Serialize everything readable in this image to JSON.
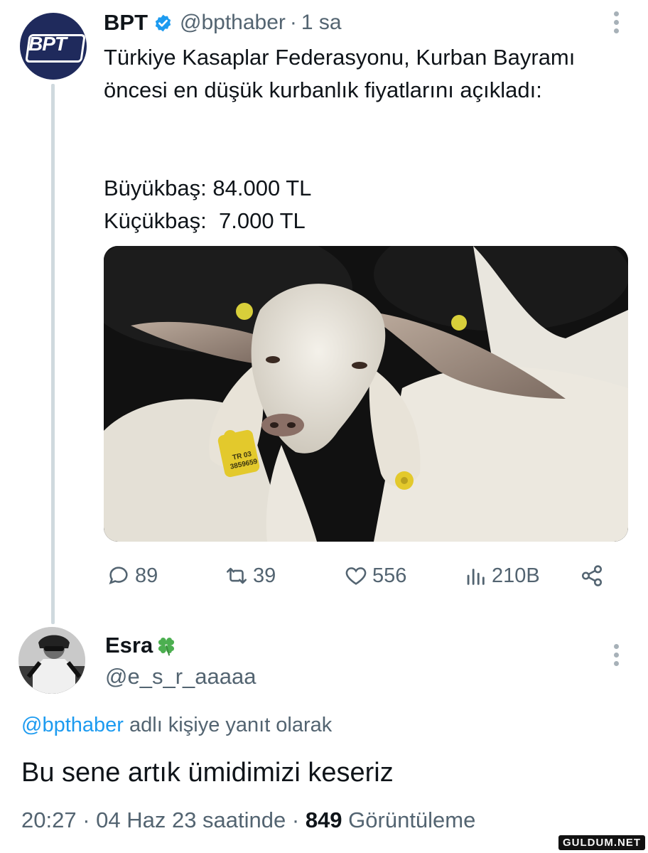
{
  "tweet": {
    "author_name": "BPT",
    "author_handle": "@bpthaber",
    "separator": "·",
    "time": "1 sa",
    "text": "Türkiye Kasaplar Federasyonu, Kurban Bayramı öncesi en düşük kurbanlık fiyatlarını açıkladı:",
    "price_big": "Büyükbaş: 84.000 TL",
    "price_small": "Küçükbaş:  7.000 TL",
    "ear_tag_text": "TR 03 3859659",
    "actions": {
      "replies": "89",
      "retweets": "39",
      "likes": "556",
      "views": "210B"
    }
  },
  "reply": {
    "author_name": "Esra",
    "author_emoji_icon": "four-leaf-clover-icon",
    "author_handle": "@e_s_r_aaaaa",
    "replying_to_mention": "@bpthaber",
    "replying_to_suffix": " adlı kişiye yanıt olarak",
    "text": "Bu sene artık ümidimizi keseriz",
    "timestamp": "20:27 · 04 Haz 23 saatinde · ",
    "views_count": "849",
    "views_label": " Görüntüleme"
  },
  "watermark": "GULDUM.NET",
  "colors": {
    "accent": "#1d9bf0",
    "secondary_text": "#536471",
    "avatar_bg": "#1f2a5c"
  }
}
